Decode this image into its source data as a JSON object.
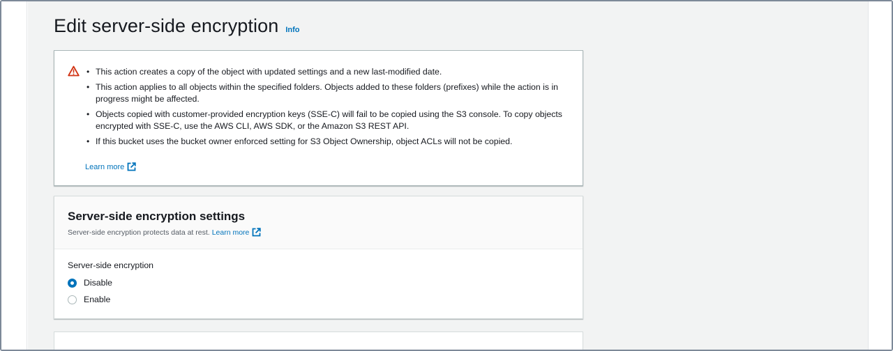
{
  "page": {
    "title": "Edit server-side encryption",
    "info_link": "Info"
  },
  "alert": {
    "icon": "warning-icon",
    "color": "#d13212",
    "bullets": [
      "This action creates a copy of the object with updated settings and a new last-modified date.",
      "This action applies to all objects within the specified folders. Objects added to these folders (prefixes) while the action is in progress might be affected.",
      "Objects copied with customer-provided encryption keys (SSE-C) will fail to be copied using the S3 console. To copy objects encrypted with SSE-C, use the AWS CLI, AWS SDK, or the Amazon S3 REST API.",
      "If this bucket uses the bucket owner enforced setting for S3 Object Ownership, object ACLs will not be copied."
    ],
    "learn_more": "Learn more"
  },
  "encryption_settings": {
    "title": "Server-side encryption settings",
    "description": "Server-side encryption protects data at rest.",
    "learn_more": "Learn more",
    "field_label": "Server-side encryption",
    "options": [
      {
        "label": "Disable",
        "selected": true
      },
      {
        "label": "Enable",
        "selected": false
      }
    ]
  },
  "colors": {
    "link": "#0073bb",
    "accent": "#0073bb"
  }
}
